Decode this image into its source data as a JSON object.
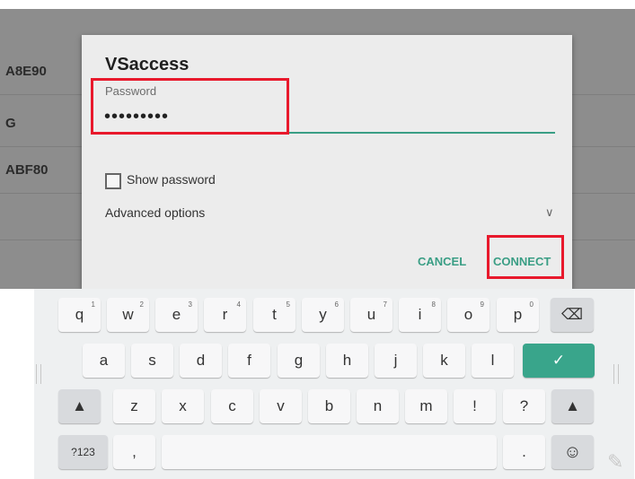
{
  "background_list": [
    "A8E90",
    "G",
    "ABF80"
  ],
  "dialog": {
    "title": "VSaccess",
    "password_label": "Password",
    "password_value": "•••••••••",
    "show_password_label": "Show password",
    "advanced_options_label": "Advanced options",
    "advanced_chevron": "∨",
    "cancel_label": "CANCEL",
    "connect_label": "CONNECT"
  },
  "keyboard": {
    "row1": [
      {
        "label": "q",
        "hint": "1"
      },
      {
        "label": "w",
        "hint": "2"
      },
      {
        "label": "e",
        "hint": "3"
      },
      {
        "label": "r",
        "hint": "4"
      },
      {
        "label": "t",
        "hint": "5"
      },
      {
        "label": "y",
        "hint": "6"
      },
      {
        "label": "u",
        "hint": "7"
      },
      {
        "label": "i",
        "hint": "8"
      },
      {
        "label": "o",
        "hint": "9"
      },
      {
        "label": "p",
        "hint": "0"
      }
    ],
    "row2": [
      "a",
      "s",
      "d",
      "f",
      "g",
      "h",
      "j",
      "k",
      "l"
    ],
    "row3": [
      "z",
      "x",
      "c",
      "v",
      "b",
      "n",
      "m",
      "!",
      "?"
    ],
    "backspace_symbol": "⌫",
    "enter_symbol": "✓",
    "shift_symbol": "▲",
    "symbols_label": "?123",
    "comma_label": ",",
    "period_label": ".",
    "emoji_symbol": "☺"
  },
  "colors": {
    "accent": "#3a9e85",
    "highlight": "#e8192c"
  }
}
